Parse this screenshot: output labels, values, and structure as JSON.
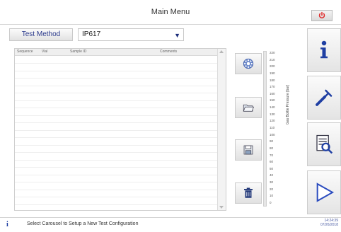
{
  "header": {
    "title": "Main Menu"
  },
  "test_method": {
    "label": "Test Method",
    "value": "IP617"
  },
  "table": {
    "columns": [
      "Sequence",
      "Vial",
      "Sample ID",
      "Comments"
    ],
    "row_count": 20
  },
  "gauge": {
    "label": "Gas Bottle Pressure [bar]",
    "ticks": [
      "220",
      "210",
      "200",
      "190",
      "180",
      "170",
      "160",
      "150",
      "140",
      "130",
      "120",
      "110",
      "100",
      "90",
      "80",
      "70",
      "60",
      "50",
      "40",
      "30",
      "20",
      "10",
      "0"
    ],
    "value": 0
  },
  "status": {
    "message": "Select Carousel to Setup a New Test Configuration",
    "time": "14:24:39",
    "date": "07/26/2018"
  },
  "colors": {
    "accent": "#1f3fa3",
    "power": "#e02b2b"
  }
}
